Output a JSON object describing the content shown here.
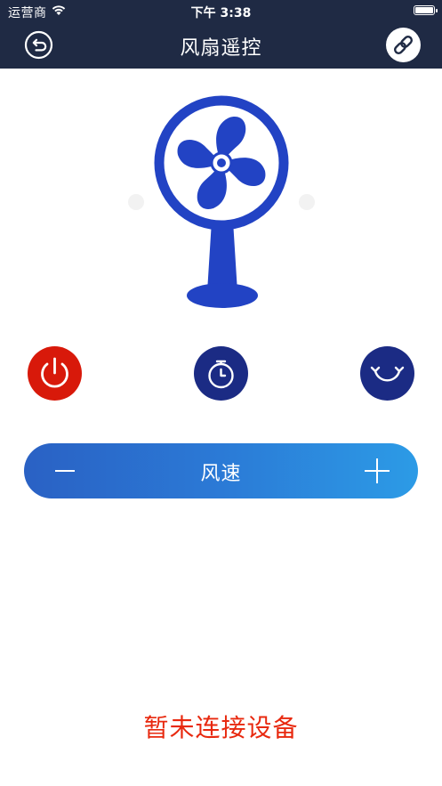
{
  "status_bar": {
    "carrier": "运营商",
    "time": "下午 3:38"
  },
  "nav": {
    "title": "风扇遥控",
    "back_icon": "back-arrow-circle-icon",
    "link_icon": "chain-link-icon"
  },
  "fan": {
    "illustration": "desk-fan-icon",
    "color": "#2243c4"
  },
  "controls": {
    "power_icon": "power-icon",
    "power_color": "#d8190a",
    "timer_icon": "stopwatch-icon",
    "timer_color": "#1b2b84",
    "swing_icon": "swing-rotate-icon",
    "swing_color": "#1b2b84"
  },
  "speed": {
    "label": "风速",
    "minus_icon": "minus-icon",
    "plus_icon": "plus-icon"
  },
  "connection_status": "暂未连接设备",
  "colors": {
    "header_bg": "#1f2a44",
    "status_text": "#e8290f"
  }
}
